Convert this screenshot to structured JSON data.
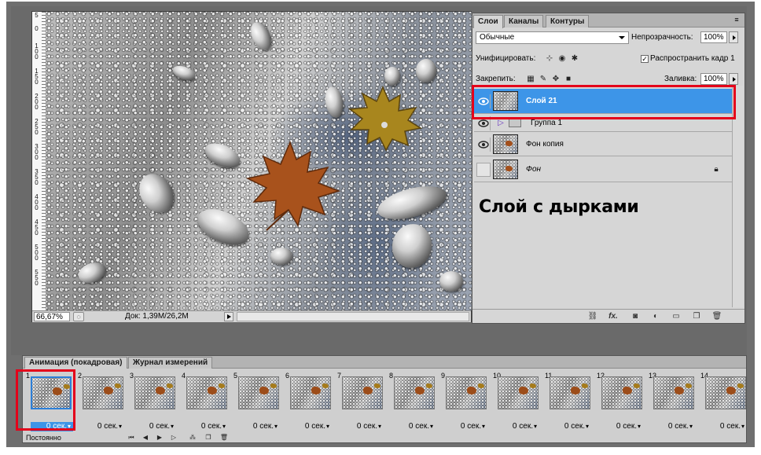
{
  "document": {
    "zoom": "66,67%",
    "doc_info": "Док: 1,39M/26,2M",
    "ruler_labels": [
      "5",
      "0",
      "1 0 0",
      "1 5 0",
      "2 0 0",
      "2 5 0",
      "3 0 0",
      "3 5 0",
      "4 0 0",
      "4 5 0",
      "5 0 0",
      "5 5 0"
    ]
  },
  "layers_panel": {
    "tabs": [
      {
        "label": "Слои"
      },
      {
        "label": "Каналы"
      },
      {
        "label": "Контуры"
      }
    ],
    "menu_glyph": "≡",
    "blend_mode": "Обычные",
    "opacity_label": "Непрозрачность:",
    "opacity_value": "100%",
    "unify_label": "Унифицировать:",
    "propagate_label": "Распространить кадр 1",
    "propagate_checked": "✓",
    "lock_label": "Закрепить:",
    "fill_label": "Заливка:",
    "fill_value": "100%",
    "layers": [
      {
        "name": "Слой 21",
        "selected": true,
        "visible": true
      },
      {
        "name": "Группа 1",
        "group": true,
        "visible": true
      },
      {
        "name": "Фон копия",
        "visible": true
      },
      {
        "name": "Фон",
        "locked": true,
        "visible": false
      }
    ],
    "annotation": "Слой с дырками",
    "footer_icons": [
      "link-icon",
      "fx-icon",
      "mask-icon",
      "adjustment-icon",
      "folder-icon",
      "new-layer-icon",
      "trash-icon"
    ],
    "fx_label": "fx."
  },
  "animation_panel": {
    "tabs": [
      {
        "label": "Анимация (покадровая)"
      },
      {
        "label": "Журнал измерений"
      }
    ],
    "frames": [
      {
        "number": "1",
        "delay": "0 сек."
      },
      {
        "number": "2",
        "delay": "0 сек."
      },
      {
        "number": "3",
        "delay": "0 сек."
      },
      {
        "number": "4",
        "delay": "0 сек."
      },
      {
        "number": "5",
        "delay": "0 сек."
      },
      {
        "number": "6",
        "delay": "0 сек."
      },
      {
        "number": "7",
        "delay": "0 сек."
      },
      {
        "number": "8",
        "delay": "0 сек."
      },
      {
        "number": "9",
        "delay": "0 сек."
      },
      {
        "number": "10",
        "delay": "0 сек."
      },
      {
        "number": "11",
        "delay": "0 сек."
      },
      {
        "number": "12",
        "delay": "0 сек."
      },
      {
        "number": "13",
        "delay": "0 сек."
      },
      {
        "number": "14",
        "delay": "0 сек."
      }
    ],
    "loop_label": "Постоянно"
  },
  "colors": {
    "selection_blue": "#3d95e8",
    "highlight_red": "#e4001a"
  }
}
